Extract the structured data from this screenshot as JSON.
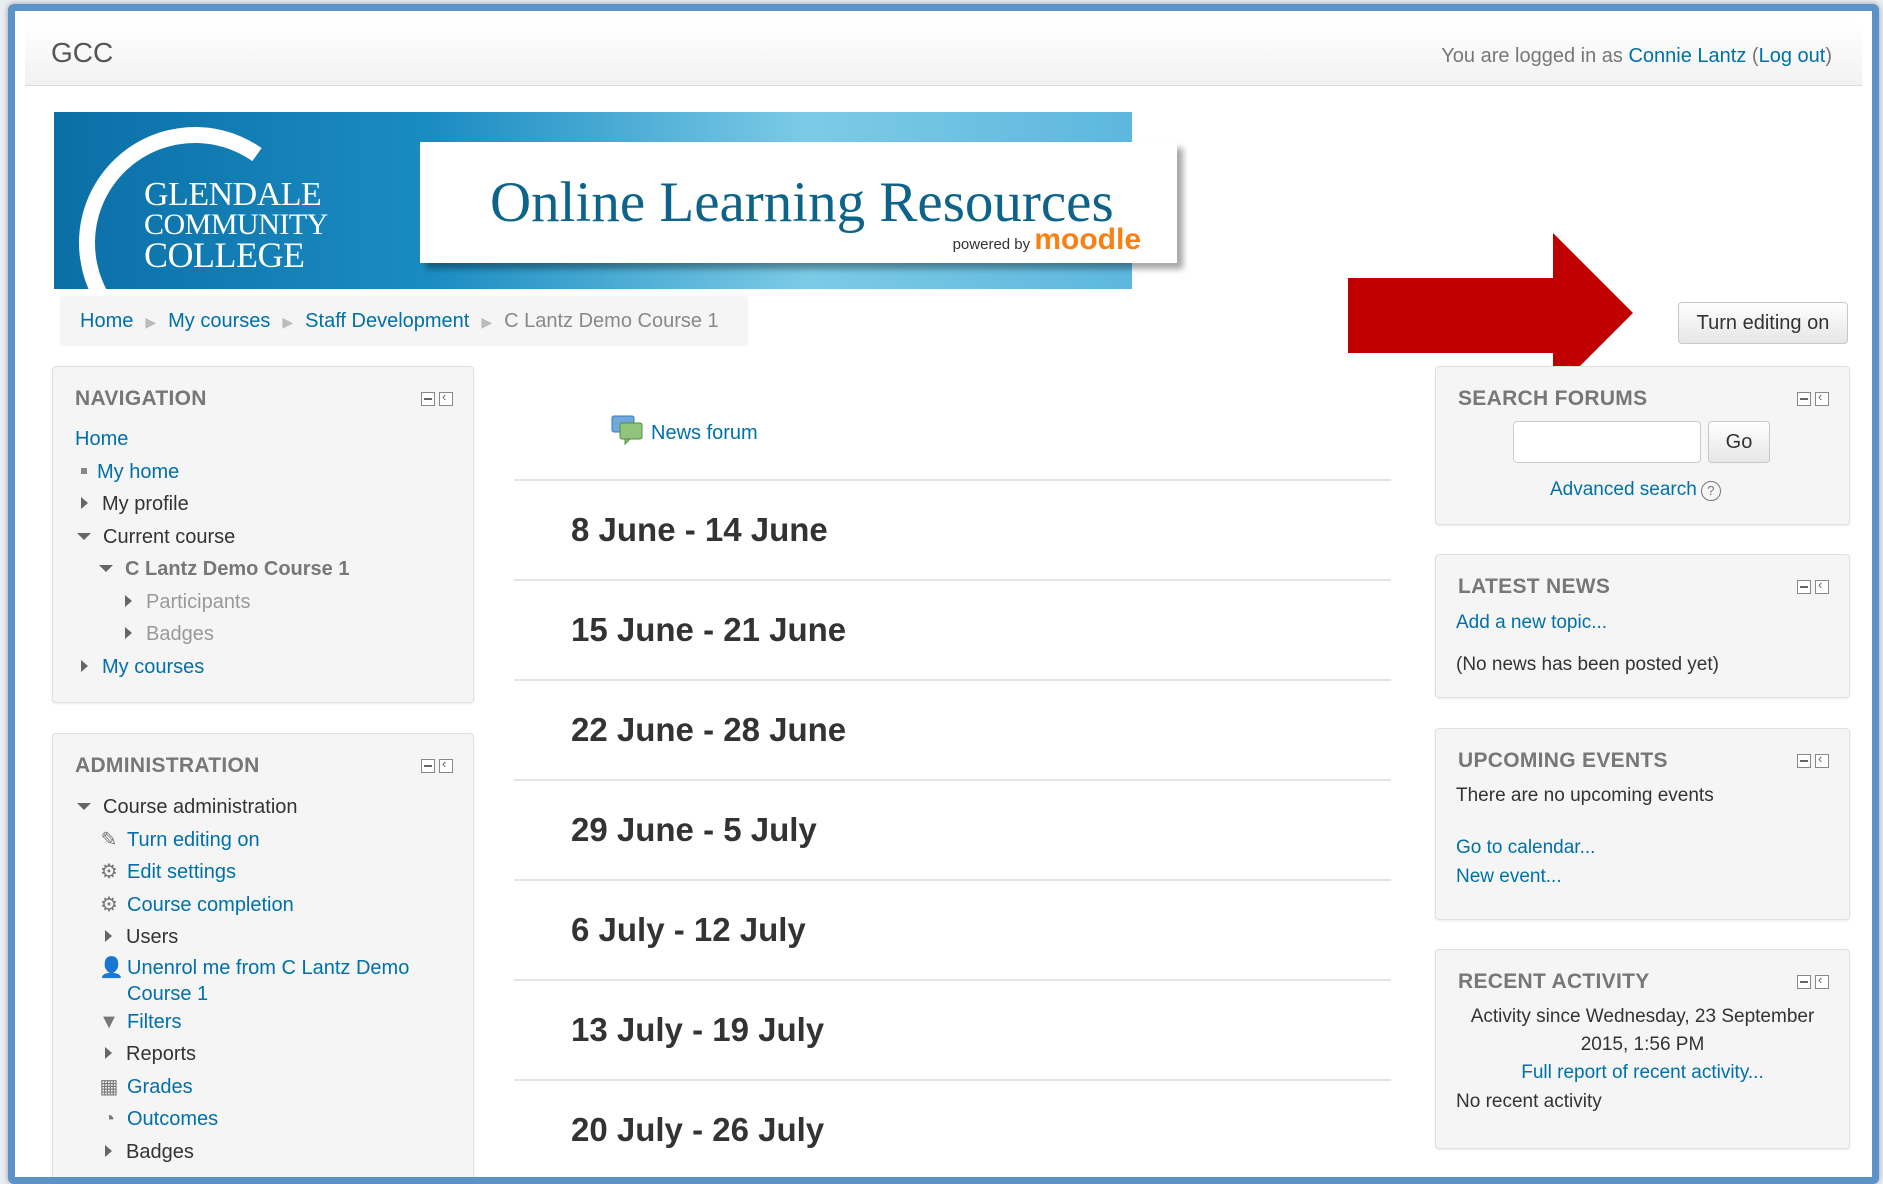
{
  "navbar": {
    "brand": "GCC",
    "login_prefix": "You are logged in as",
    "user_name": "Connie Lantz",
    "logout": "Log out"
  },
  "banner": {
    "college_line1": "GLENDALE",
    "college_line2": "COMMUNITY",
    "college_line3": "COLLEGE",
    "title": "Online Learning Resources",
    "powered_by": "powered by",
    "moodle": "moodle"
  },
  "breadcrumb": {
    "items": [
      "Home",
      "My courses",
      "Staff Development"
    ],
    "current": "C Lantz Demo Course 1"
  },
  "edit_button": "Turn editing on",
  "navigation": {
    "title": "NAVIGATION",
    "home": "Home",
    "my_home": "My home",
    "my_profile": "My profile",
    "current_course": "Current course",
    "course_name": "C Lantz Demo Course 1",
    "participants": "Participants",
    "badges": "Badges",
    "my_courses": "My courses"
  },
  "administration": {
    "title": "ADMINISTRATION",
    "course_admin": "Course administration",
    "turn_editing_on": "Turn editing on",
    "edit_settings": "Edit settings",
    "course_completion": "Course completion",
    "users": "Users",
    "unenrol_line1": "Unenrol me from C Lantz Demo",
    "unenrol_line2": "Course 1",
    "filters": "Filters",
    "reports": "Reports",
    "grades": "Grades",
    "outcomes": "Outcomes",
    "badges": "Badges"
  },
  "center": {
    "news_forum": "News forum",
    "weeks": [
      "8 June - 14 June",
      "15 June - 21 June",
      "22 June - 28 June",
      "29 June - 5 July",
      "6 July - 12 July",
      "13 July - 19 July",
      "20 July - 26 July"
    ]
  },
  "search_forums": {
    "title": "SEARCH FORUMS",
    "input_value": "",
    "go": "Go",
    "advanced": "Advanced search"
  },
  "latest_news": {
    "title": "LATEST NEWS",
    "add_topic": "Add a new topic...",
    "empty": "(No news has been posted yet)"
  },
  "upcoming_events": {
    "title": "UPCOMING EVENTS",
    "empty": "There are no upcoming events",
    "calendar": "Go to calendar...",
    "new_event": "New event..."
  },
  "recent_activity": {
    "title": "RECENT ACTIVITY",
    "since_line1": "Activity since Wednesday, 23 September",
    "since_line2": "2015, 1:56 PM",
    "full_report": "Full report of recent activity...",
    "none": "No recent activity"
  },
  "colors": {
    "link": "#0070a8",
    "frame_border": "#5b93c9",
    "arrow": "#c00000",
    "banner_blue": "#0b6fa6"
  }
}
